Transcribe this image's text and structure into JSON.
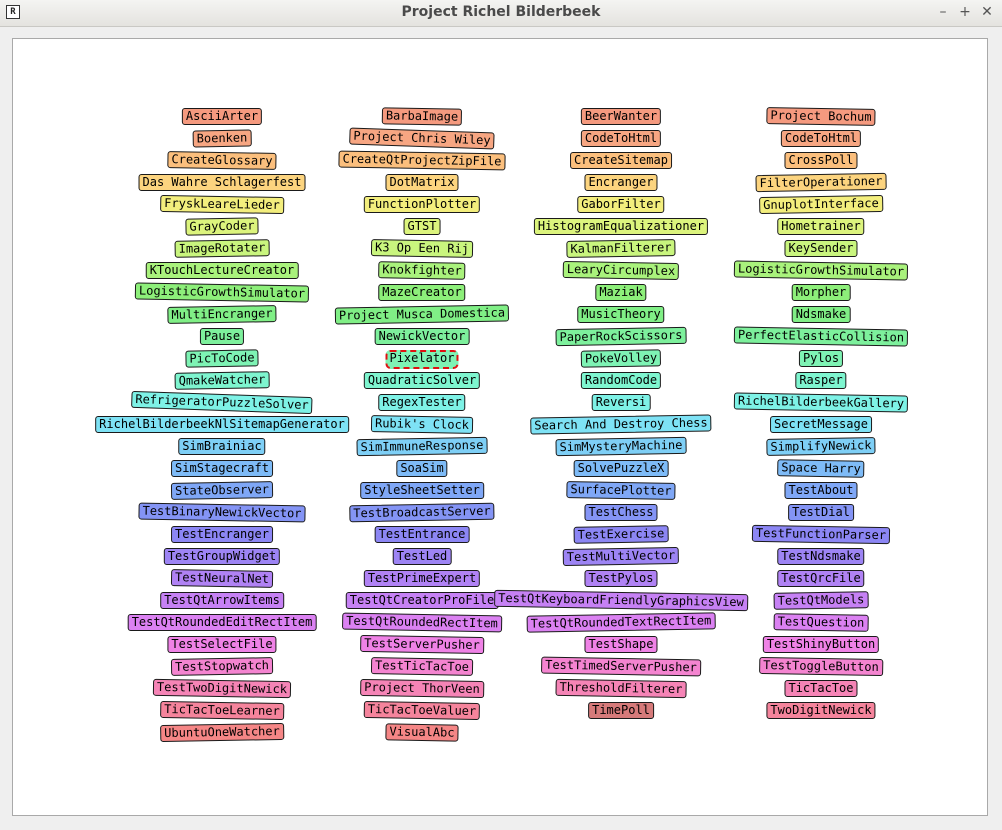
{
  "window": {
    "title": "Project Richel Bilderbeek",
    "icon": "R",
    "minimize_label": "–",
    "maximize_label": "+",
    "close_label": "✕"
  },
  "focused_item": "Pixelator",
  "columns": [
    {
      "items": [
        {
          "label": "AsciiArter",
          "color": "#f59a7f",
          "tilt": 0
        },
        {
          "label": "Boenken",
          "color": "#f7a682",
          "tilt": -1
        },
        {
          "label": "CreateGlossary",
          "color": "#fbbf7d",
          "tilt": 1
        },
        {
          "label": "Das Wahre Schlagerfest",
          "color": "#fcd47f",
          "tilt": 0
        },
        {
          "label": "FryskLeareLieder",
          "color": "#f3ee7d",
          "tilt": 1
        },
        {
          "label": "GrayCoder",
          "color": "#dcf47d",
          "tilt": -1
        },
        {
          "label": "ImageRotater",
          "color": "#c9f57e",
          "tilt": -1
        },
        {
          "label": "KTouchLectureCreator",
          "color": "#a9f27c",
          "tilt": 0
        },
        {
          "label": "LogisticGrowthSimulator",
          "color": "#8def7a",
          "tilt": 1
        },
        {
          "label": "MultiEncranger",
          "color": "#80ef86",
          "tilt": -1
        },
        {
          "label": "Pause",
          "color": "#7df09c",
          "tilt": 0
        },
        {
          "label": "PicToCode",
          "color": "#7ef3b4",
          "tilt": -1
        },
        {
          "label": "QmakeWatcher",
          "color": "#7ef5cf",
          "tilt": -1
        },
        {
          "label": "RefrigeratorPuzzleSolver",
          "color": "#7ef2e6",
          "tilt": 2
        },
        {
          "label": "RichelBilderbeekNlSitemapGenerator",
          "color": "#7ee2f5",
          "tilt": 0
        },
        {
          "label": "SimBrainiac",
          "color": "#7ecff6",
          "tilt": 0
        },
        {
          "label": "SimStagecraft",
          "color": "#7ebbf7",
          "tilt": 0
        },
        {
          "label": "StateObserver",
          "color": "#7fa7f6",
          "tilt": -1
        },
        {
          "label": "TestBinaryNewickVector",
          "color": "#8494f5",
          "tilt": 1
        },
        {
          "label": "TestEncranger",
          "color": "#8c86f4",
          "tilt": 0
        },
        {
          "label": "TestGroupWidget",
          "color": "#9d84f4",
          "tilt": 0
        },
        {
          "label": "TestNeuralNet",
          "color": "#b082f4",
          "tilt": 1
        },
        {
          "label": "TestQtArrowItems",
          "color": "#c681f4",
          "tilt": 0
        },
        {
          "label": "TestQtRoundedEditRectItem",
          "color": "#db81f2",
          "tilt": 0
        },
        {
          "label": "TestSelectFile",
          "color": "#ef82e6",
          "tilt": 0
        },
        {
          "label": "TestStopwatch",
          "color": "#f484d0",
          "tilt": -1
        },
        {
          "label": "TestTwoDigitNewick",
          "color": "#f584b6",
          "tilt": 1
        },
        {
          "label": "TicTacToeLearner",
          "color": "#f5849c",
          "tilt": 1
        },
        {
          "label": "UbuntuOneWatcher",
          "color": "#f58686",
          "tilt": -1
        }
      ]
    },
    {
      "items": [
        {
          "label": "BarbaImage",
          "color": "#f59a7f",
          "tilt": 1
        },
        {
          "label": "Project Chris Wiley",
          "color": "#f7a682",
          "tilt": 2
        },
        {
          "label": "CreateQtProjectZipFile",
          "color": "#fbbf7d",
          "tilt": 1
        },
        {
          "label": "DotMatrix",
          "color": "#fcd47f",
          "tilt": 0
        },
        {
          "label": "FunctionPlotter",
          "color": "#f3ee7d",
          "tilt": 0
        },
        {
          "label": "GTST",
          "color": "#dcf47d",
          "tilt": 0
        },
        {
          "label": "K3 Op Een Rij",
          "color": "#c9f57e",
          "tilt": 1
        },
        {
          "label": "Knokfighter",
          "color": "#a9f27c",
          "tilt": 1
        },
        {
          "label": "MazeCreator",
          "color": "#8def7a",
          "tilt": 0
        },
        {
          "label": "Project Musca Domestica",
          "color": "#80ef86",
          "tilt": -1
        },
        {
          "label": "NewickVector",
          "color": "#7df09c",
          "tilt": 0
        },
        {
          "label": "Pixelator",
          "color": "#7ef3b4",
          "tilt": 0
        },
        {
          "label": "QuadraticSolver",
          "color": "#7ef5cf",
          "tilt": 0
        },
        {
          "label": "RegexTester",
          "color": "#7ef2e6",
          "tilt": 0
        },
        {
          "label": "Rubik's Clock",
          "color": "#7ee2f5",
          "tilt": 1
        },
        {
          "label": "SimImmuneResponse",
          "color": "#7ecff6",
          "tilt": -1
        },
        {
          "label": "SoaSim",
          "color": "#7ebbf7",
          "tilt": 0
        },
        {
          "label": "StyleSheetSetter",
          "color": "#7fa7f6",
          "tilt": 0
        },
        {
          "label": "TestBroadcastServer",
          "color": "#8494f5",
          "tilt": -1
        },
        {
          "label": "TestEntrance",
          "color": "#8c86f4",
          "tilt": 0
        },
        {
          "label": "TestLed",
          "color": "#9d84f4",
          "tilt": 0
        },
        {
          "label": "TestPrimeExpert",
          "color": "#b082f4",
          "tilt": 0
        },
        {
          "label": "TestQtCreatorProFile",
          "color": "#c681f4",
          "tilt": 0
        },
        {
          "label": "TestQtRoundedRectItem",
          "color": "#db81f2",
          "tilt": 1
        },
        {
          "label": "TestServerPusher",
          "color": "#ef82e6",
          "tilt": 1
        },
        {
          "label": "TestTicTacToe",
          "color": "#f484d0",
          "tilt": 1
        },
        {
          "label": "Project ThorVeen",
          "color": "#f584b6",
          "tilt": 1
        },
        {
          "label": "TicTacToeValuer",
          "color": "#f5849c",
          "tilt": 1
        },
        {
          "label": "VisualAbc",
          "color": "#f58686",
          "tilt": 1
        }
      ]
    },
    {
      "items": [
        {
          "label": "BeerWanter",
          "color": "#f59a7f",
          "tilt": 0
        },
        {
          "label": "CodeToHtml",
          "color": "#f7a682",
          "tilt": 0
        },
        {
          "label": "CreateSitemap",
          "color": "#fbbf7d",
          "tilt": 0
        },
        {
          "label": "Encranger",
          "color": "#fcd47f",
          "tilt": 0
        },
        {
          "label": "GaborFilter",
          "color": "#f3ee7d",
          "tilt": 0
        },
        {
          "label": "HistogramEqualizationer",
          "color": "#dcf47d",
          "tilt": 0
        },
        {
          "label": "KalmanFilterer",
          "color": "#c9f57e",
          "tilt": -1
        },
        {
          "label": "LearyCircumplex",
          "color": "#a9f27c",
          "tilt": 1
        },
        {
          "label": "Maziak",
          "color": "#8def7a",
          "tilt": 0
        },
        {
          "label": "MusicTheory",
          "color": "#80ef86",
          "tilt": 0
        },
        {
          "label": "PaperRockScissors",
          "color": "#7df09c",
          "tilt": -1
        },
        {
          "label": "PokeVolley",
          "color": "#7ef3b4",
          "tilt": -1
        },
        {
          "label": "RandomCode",
          "color": "#7ef5cf",
          "tilt": 0
        },
        {
          "label": "Reversi",
          "color": "#7ef2e6",
          "tilt": 0
        },
        {
          "label": "Search And Destroy Chess",
          "color": "#7ee2f5",
          "tilt": -1
        },
        {
          "label": "SimMysteryMachine",
          "color": "#7ecff6",
          "tilt": -1
        },
        {
          "label": "SolvePuzzleX",
          "color": "#7ebbf7",
          "tilt": 0
        },
        {
          "label": "SurfacePlotter",
          "color": "#7fa7f6",
          "tilt": 1
        },
        {
          "label": "TestChess",
          "color": "#8494f5",
          "tilt": 0
        },
        {
          "label": "TestExercise",
          "color": "#8c86f4",
          "tilt": -1
        },
        {
          "label": "TestMultiVector",
          "color": "#9d84f4",
          "tilt": -1
        },
        {
          "label": "TestPylos",
          "color": "#b082f4",
          "tilt": 0
        },
        {
          "label": "TestQtKeyboardFriendlyGraphicsView",
          "color": "#c681f4",
          "tilt": 1
        },
        {
          "label": "TestQtRoundedTextRectItem",
          "color": "#db81f2",
          "tilt": -1
        },
        {
          "label": "TestShape",
          "color": "#ef82e6",
          "tilt": 0
        },
        {
          "label": "TestTimedServerPusher",
          "color": "#f484d0",
          "tilt": 1
        },
        {
          "label": "ThresholdFilterer",
          "color": "#f584b6",
          "tilt": 1
        },
        {
          "label": "TimePoll",
          "color": "#d67a7a",
          "tilt": 0
        }
      ]
    },
    {
      "items": [
        {
          "label": "Project Bochum",
          "color": "#f59a7f",
          "tilt": 1
        },
        {
          "label": "CodeToHtml",
          "color": "#f7a682",
          "tilt": 0
        },
        {
          "label": "CrossPoll",
          "color": "#fbbf7d",
          "tilt": 0
        },
        {
          "label": "FilterOperationer",
          "color": "#fcd47f",
          "tilt": -1
        },
        {
          "label": "GnuplotInterface",
          "color": "#f3ee7d",
          "tilt": -1
        },
        {
          "label": "Hometrainer",
          "color": "#dcf47d",
          "tilt": 0
        },
        {
          "label": "KeySender",
          "color": "#c9f57e",
          "tilt": 0
        },
        {
          "label": "LogisticGrowthSimulator",
          "color": "#a9f27c",
          "tilt": 1
        },
        {
          "label": "Morpher",
          "color": "#8def7a",
          "tilt": 0
        },
        {
          "label": "Ndsmake",
          "color": "#80ef86",
          "tilt": 0
        },
        {
          "label": "PerfectElasticCollision",
          "color": "#7df09c",
          "tilt": 1
        },
        {
          "label": "Pylos",
          "color": "#7ef3b4",
          "tilt": 0
        },
        {
          "label": "Rasper",
          "color": "#7ef5cf",
          "tilt": 0
        },
        {
          "label": "RichelBilderbeekGallery",
          "color": "#7ef2e6",
          "tilt": 1
        },
        {
          "label": "SecretMessage",
          "color": "#7ee2f5",
          "tilt": 0
        },
        {
          "label": "SimplifyNewick",
          "color": "#7ecff6",
          "tilt": -1
        },
        {
          "label": "Space Harry",
          "color": "#7ebbf7",
          "tilt": 1
        },
        {
          "label": "TestAbout",
          "color": "#7fa7f6",
          "tilt": 0
        },
        {
          "label": "TestDial",
          "color": "#8494f5",
          "tilt": 0
        },
        {
          "label": "TestFunctionParser",
          "color": "#8c86f4",
          "tilt": 1
        },
        {
          "label": "TestNdsmake",
          "color": "#9d84f4",
          "tilt": 0
        },
        {
          "label": "TestQrcFile",
          "color": "#b082f4",
          "tilt": 0
        },
        {
          "label": "TestQtModels",
          "color": "#c681f4",
          "tilt": -1
        },
        {
          "label": "TestQuestion",
          "color": "#db81f2",
          "tilt": 1
        },
        {
          "label": "TestShinyButton",
          "color": "#ef82e6",
          "tilt": 0
        },
        {
          "label": "TestToggleButton",
          "color": "#f484d0",
          "tilt": 1
        },
        {
          "label": "TicTacToe",
          "color": "#f584b6",
          "tilt": 0
        },
        {
          "label": "TwoDigitNewick",
          "color": "#f5849c",
          "tilt": 0
        }
      ]
    }
  ]
}
